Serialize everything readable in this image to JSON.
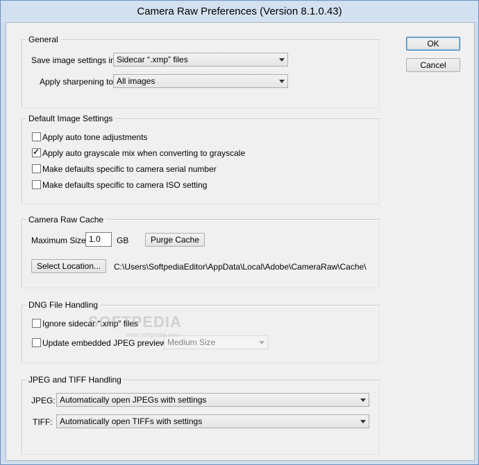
{
  "window": {
    "title": "Camera Raw Preferences  (Version 8.1.0.43)"
  },
  "buttons": {
    "ok": "OK",
    "cancel": "Cancel"
  },
  "general": {
    "legend": "General",
    "save_label": "Save image settings in:",
    "save_value": "Sidecar “.xmp” files",
    "sharpen_label": "Apply sharpening to:",
    "sharpen_value": "All images"
  },
  "default_image": {
    "legend": "Default Image Settings",
    "options": [
      {
        "label": "Apply auto tone adjustments",
        "checked": false
      },
      {
        "label": "Apply auto grayscale mix when converting to grayscale",
        "checked": true
      },
      {
        "label": "Make defaults specific to camera serial number",
        "checked": false
      },
      {
        "label": "Make defaults specific to camera ISO setting",
        "checked": false
      }
    ]
  },
  "cache": {
    "legend": "Camera Raw Cache",
    "max_size_label": "Maximum Size:",
    "max_size_value": "1.0",
    "unit": "GB",
    "purge_label": "Purge Cache",
    "select_location_label": "Select Location...",
    "path": "C:\\Users\\SoftpediaEditor\\AppData\\Local\\Adobe\\CameraRaw\\Cache\\"
  },
  "dng": {
    "legend": "DNG File Handling",
    "ignore_label": "Ignore sidecar “.xmp” files",
    "ignore_checked": false,
    "update_label": "Update embedded JPEG previews:",
    "update_checked": false,
    "preview_value": "Medium Size"
  },
  "jpeg_tiff": {
    "legend": "JPEG and TIFF Handling",
    "jpeg_label": "JPEG:",
    "jpeg_value": "Automatically open JPEGs with settings",
    "tiff_label": "TIFF:",
    "tiff_value": "Automatically open TIFFs with settings"
  },
  "watermark": {
    "brand": "SOFTPEDIA",
    "sub": "www.softpedia.com"
  }
}
